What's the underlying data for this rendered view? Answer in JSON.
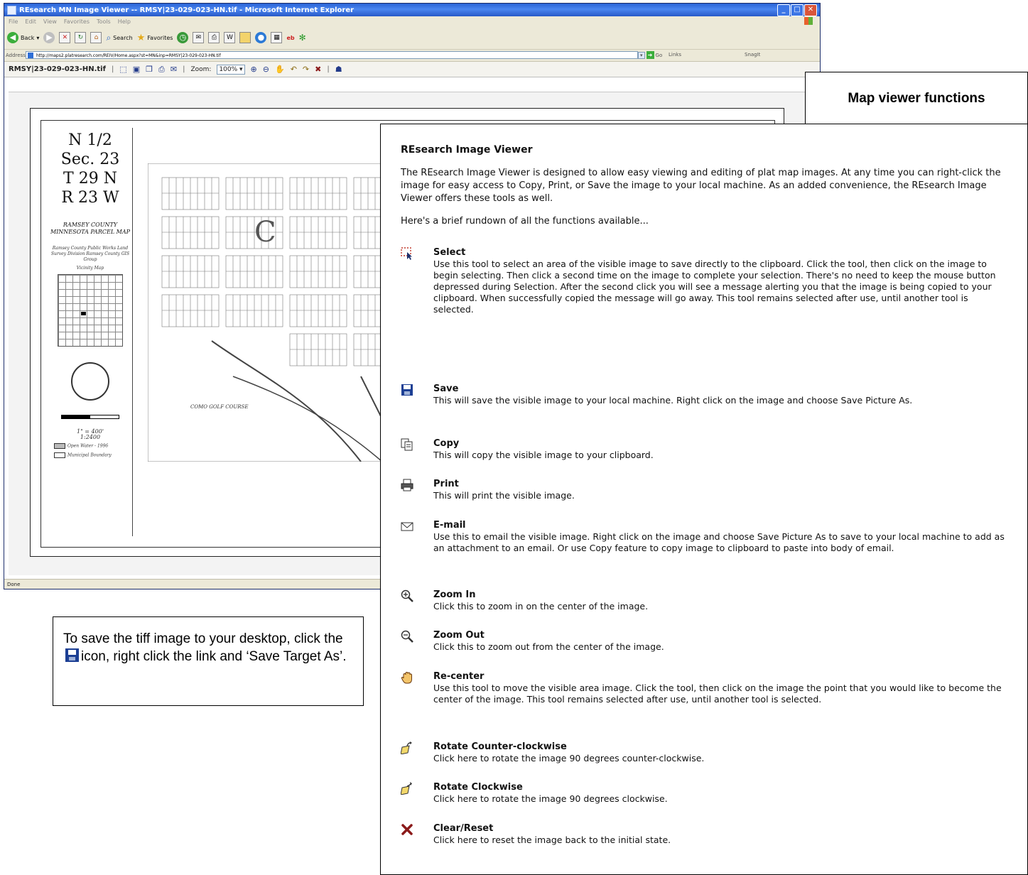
{
  "window": {
    "title": "REsearch MN Image Viewer -- RMSY|23-029-023-HN.tif - Microsoft Internet Explorer",
    "menu": [
      "File",
      "Edit",
      "View",
      "Favorites",
      "Tools",
      "Help"
    ],
    "toolbar": {
      "back": "Back",
      "search": "Search",
      "favorites": "Favorites"
    },
    "address_label": "Address",
    "address_url": "http://maps2.platresearch.com/REIV/Home.aspx?st=MN&inp=RMSY|23-029-023-HN.tif",
    "go_label": "Go",
    "links_label": "Links",
    "snagit_label": "SnagIt",
    "status": "Done"
  },
  "viewer": {
    "filename": "RMSY|23-029-023-HN.tif",
    "zoom_label": "Zoom:",
    "zoom_value": "100%"
  },
  "map": {
    "section_lines": [
      "N 1/2",
      "Sec. 23",
      "T 29 N",
      "R 23 W"
    ],
    "county_title": "RAMSEY COUNTY MINNESOTA PARCEL MAP",
    "publisher": "Ramsey County Public Works Land Survey Division Ramsey County GIS Group",
    "vicinity_label": "Vicinity Map",
    "scale_text": "1\" = 400'",
    "scale_ratio": "1:2400",
    "legend_open_water": "Open Water - 1996",
    "legend_boundary": "Municipal Boundary",
    "course_label": "COMO GOLF COURSE"
  },
  "callouts": {
    "map_functions": "Map viewer functions",
    "save_before": "To save the tiff image to your desktop, click the",
    "save_after": "icon, right click the link and ‘Save Target As’."
  },
  "help": {
    "title": "REsearch Image Viewer",
    "intro": "The REsearch Image Viewer is designed to allow easy viewing and editing of plat map images. At any time you can right-click the image for easy access to Copy, Print, or Save the image to your local machine. As an added convenience, the REsearch Image Viewer offers these tools as well.",
    "rundown": "Here's a brief rundown of all the functions available...",
    "items": [
      {
        "name": "Select",
        "icon": "select-icon",
        "desc": "Use this tool to select an area of the visible image to save directly to the clipboard. Click the tool, then click on the image to begin selecting. Then click a second time on the image to complete your selection. There's no need to keep the mouse button depressed during Selection. After the second click you will see a message alerting you that the image is being copied to your clipboard. When successfully copied the message will go away. This tool remains selected after use, until another tool is selected."
      },
      {
        "name": "Save",
        "icon": "save-icon",
        "desc": "This will save the visible image to your local machine. Right click on the image and choose Save Picture As."
      },
      {
        "name": "Copy",
        "icon": "copy-icon",
        "desc": "This will copy the visible image to your clipboard."
      },
      {
        "name": "Print",
        "icon": "print-icon",
        "desc": "This will print the visible image."
      },
      {
        "name": "E-mail",
        "icon": "email-icon",
        "desc": "Use this to email the visible image. Right click on the image and choose Save Picture As to save to your local machine to add as an attachment to an email. Or use Copy feature to copy image to clipboard to paste into body of email."
      },
      {
        "name": "Zoom In",
        "icon": "zoom-in-icon",
        "desc": "Click this to zoom in on the center of the image."
      },
      {
        "name": "Zoom Out",
        "icon": "zoom-out-icon",
        "desc": "Click this to zoom out from the center of the image."
      },
      {
        "name": "Re-center",
        "icon": "hand-icon",
        "desc": "Use this tool to move the visible area image. Click the tool, then click on the image the point that you would like to become the center of the image. This tool remains selected after use, until another tool is selected."
      },
      {
        "name": "Rotate Counter-clockwise",
        "icon": "rotate-ccw-icon",
        "desc": "Click here to rotate the image 90 degrees counter-clockwise."
      },
      {
        "name": "Rotate Clockwise",
        "icon": "rotate-cw-icon",
        "desc": "Click here to rotate the image 90 degrees clockwise."
      },
      {
        "name": "Clear/Reset",
        "icon": "clear-icon",
        "desc": "Click here to reset the image back to the initial state."
      }
    ]
  },
  "colors": {
    "xp_title": "#2a63d6",
    "save_icon": "#1c3f94",
    "clear_icon": "#8b1a1a"
  }
}
